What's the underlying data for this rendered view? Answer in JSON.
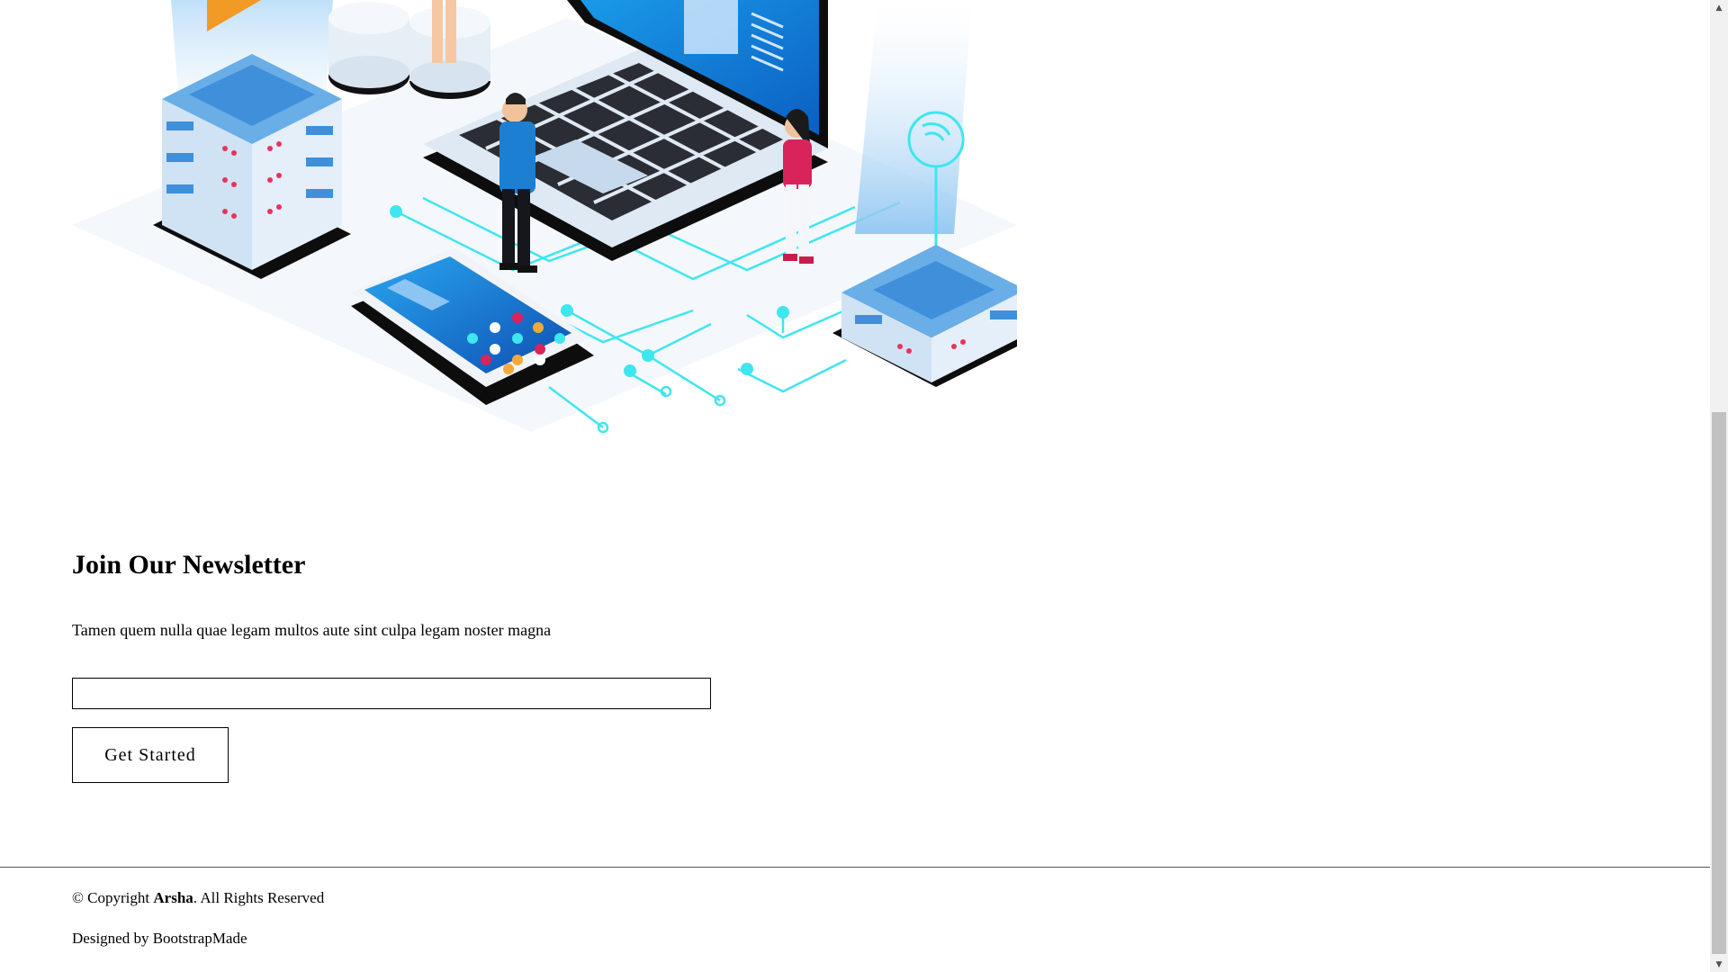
{
  "newsletter": {
    "heading": "Join Our Newsletter",
    "description": "Tamen quem nulla quae legam multos aute sint culpa legam noster magna",
    "email_value": "",
    "email_placeholder": "",
    "submit_label": "Get Started"
  },
  "footer": {
    "copyright_prefix": "© Copyright ",
    "brand": "Arsha",
    "copyright_suffix": ". All Rights Reserved",
    "credits": "Designed by BootstrapMade"
  },
  "scrollbar": {
    "up_icon": "▲",
    "down_icon": "▼"
  },
  "colors": {
    "accent_cyan": "#3ee6f0",
    "illustration_blue": "#1e88e5",
    "dark": "#111111"
  }
}
